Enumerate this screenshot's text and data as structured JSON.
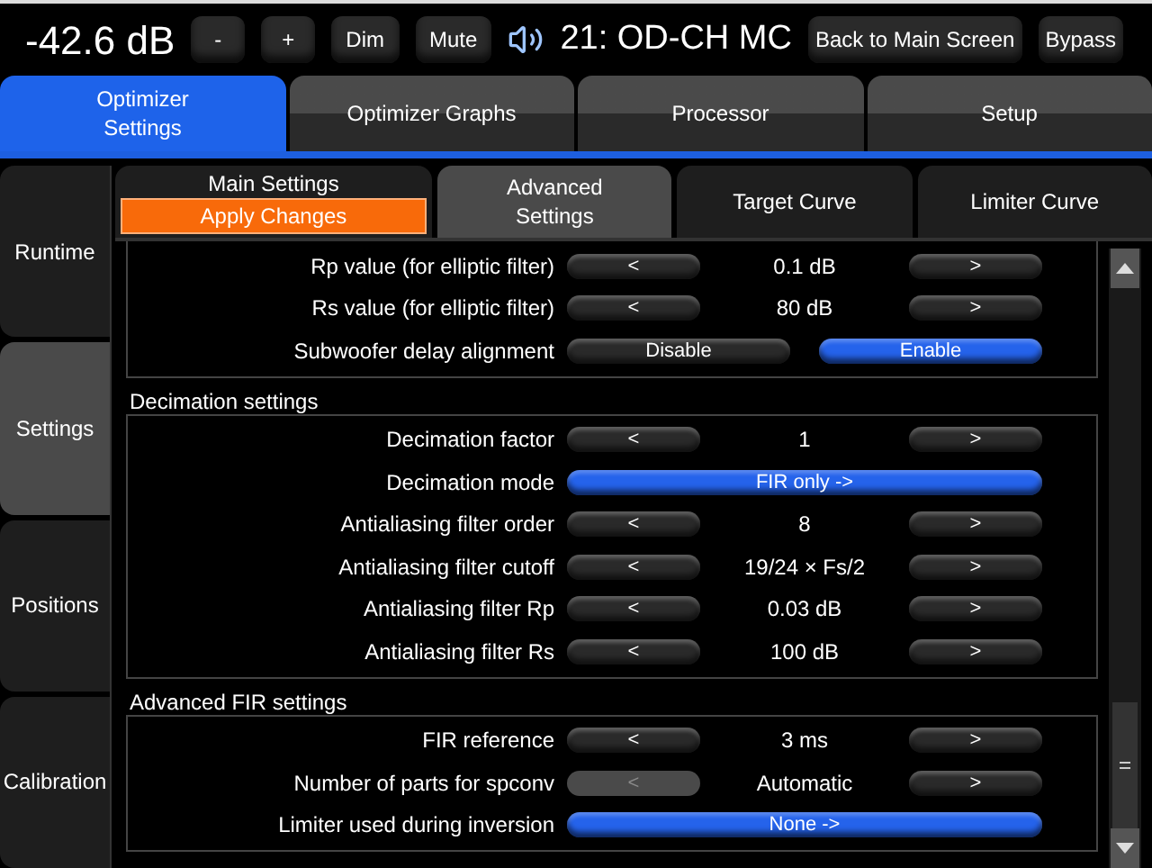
{
  "top_bar": {
    "volume": "-42.6 dB",
    "buttons": [
      "-",
      "+",
      "Dim",
      "Mute"
    ],
    "preset": "21: OD-CH MC",
    "right_buttons": [
      "Back to Main Screen",
      "Bypass"
    ]
  },
  "main_tabs": [
    {
      "label": "Optimizer Settings",
      "selected": true
    },
    {
      "label": "Optimizer Graphs",
      "selected": false
    },
    {
      "label": "Processor",
      "selected": false
    },
    {
      "label": "Setup",
      "selected": false
    }
  ],
  "side_tabs": [
    {
      "label": "Runtime",
      "selected": false
    },
    {
      "label": "Settings",
      "selected": true
    },
    {
      "label": "Positions",
      "selected": false
    },
    {
      "label": "Calibration",
      "selected": false
    }
  ],
  "sub_tabs": [
    {
      "label": "Main Settings",
      "action": "Apply Changes",
      "selected": false
    },
    {
      "label": "Advanced Settings",
      "selected": true
    },
    {
      "label": "Target Curve",
      "selected": false
    },
    {
      "label": "Limiter Curve",
      "selected": false
    }
  ],
  "groups": [
    {
      "rows": [
        {
          "kind": "stepper",
          "label": "Rp value (for elliptic filter)",
          "prev": "<",
          "value": "0.1 dB",
          "next": ">",
          "prev_disabled": false
        },
        {
          "kind": "stepper",
          "label": "Rs value (for elliptic filter)",
          "prev": "<",
          "value": "80 dB",
          "next": ">",
          "prev_disabled": false
        },
        {
          "kind": "toggle",
          "label": "Subwoofer delay alignment",
          "options": [
            {
              "label": "Disable",
              "selected": false
            },
            {
              "label": "Enable",
              "selected": true
            }
          ]
        }
      ]
    },
    {
      "title": "Decimation settings",
      "rows": [
        {
          "kind": "stepper",
          "label": "Decimation factor",
          "prev": "<",
          "value": "1",
          "next": ">",
          "prev_disabled": false
        },
        {
          "kind": "select",
          "label": "Decimation mode",
          "value": "FIR only ->"
        },
        {
          "kind": "stepper",
          "label": "Antialiasing filter order",
          "prev": "<",
          "value": "8",
          "next": ">",
          "prev_disabled": false
        },
        {
          "kind": "stepper",
          "label": "Antialiasing filter cutoff",
          "prev": "<",
          "value": "19/24 × Fs/2",
          "next": ">",
          "prev_disabled": false
        },
        {
          "kind": "stepper",
          "label": "Antialiasing filter Rp",
          "prev": "<",
          "value": "0.03 dB",
          "next": ">",
          "prev_disabled": false
        },
        {
          "kind": "stepper",
          "label": "Antialiasing filter Rs",
          "prev": "<",
          "value": "100 dB",
          "next": ">",
          "prev_disabled": false
        }
      ]
    },
    {
      "title": "Advanced FIR settings",
      "rows": [
        {
          "kind": "stepper",
          "label": "FIR reference",
          "prev": "<",
          "value": "3 ms",
          "next": ">",
          "prev_disabled": false
        },
        {
          "kind": "stepper",
          "label": "Number of parts for spconv",
          "prev": "<",
          "value": "Automatic",
          "next": ">",
          "prev_disabled": true
        },
        {
          "kind": "select",
          "label": "Limiter used during inversion",
          "value": "None ->"
        }
      ]
    }
  ]
}
